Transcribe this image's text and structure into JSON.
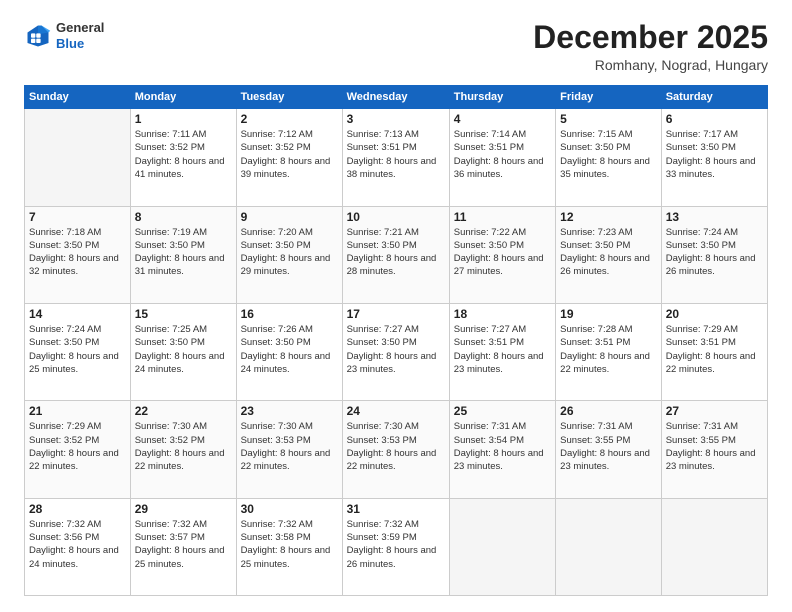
{
  "header": {
    "logo": {
      "general": "General",
      "blue": "Blue"
    },
    "title": "December 2025",
    "subtitle": "Romhany, Nograd, Hungary"
  },
  "days_of_week": [
    "Sunday",
    "Monday",
    "Tuesday",
    "Wednesday",
    "Thursday",
    "Friday",
    "Saturday"
  ],
  "weeks": [
    [
      {
        "day": "",
        "empty": true
      },
      {
        "day": "1",
        "sunrise": "7:11 AM",
        "sunset": "3:52 PM",
        "daylight": "8 hours and 41 minutes."
      },
      {
        "day": "2",
        "sunrise": "7:12 AM",
        "sunset": "3:52 PM",
        "daylight": "8 hours and 39 minutes."
      },
      {
        "day": "3",
        "sunrise": "7:13 AM",
        "sunset": "3:51 PM",
        "daylight": "8 hours and 38 minutes."
      },
      {
        "day": "4",
        "sunrise": "7:14 AM",
        "sunset": "3:51 PM",
        "daylight": "8 hours and 36 minutes."
      },
      {
        "day": "5",
        "sunrise": "7:15 AM",
        "sunset": "3:50 PM",
        "daylight": "8 hours and 35 minutes."
      },
      {
        "day": "6",
        "sunrise": "7:17 AM",
        "sunset": "3:50 PM",
        "daylight": "8 hours and 33 minutes."
      }
    ],
    [
      {
        "day": "7",
        "sunrise": "7:18 AM",
        "sunset": "3:50 PM",
        "daylight": "8 hours and 32 minutes."
      },
      {
        "day": "8",
        "sunrise": "7:19 AM",
        "sunset": "3:50 PM",
        "daylight": "8 hours and 31 minutes."
      },
      {
        "day": "9",
        "sunrise": "7:20 AM",
        "sunset": "3:50 PM",
        "daylight": "8 hours and 29 minutes."
      },
      {
        "day": "10",
        "sunrise": "7:21 AM",
        "sunset": "3:50 PM",
        "daylight": "8 hours and 28 minutes."
      },
      {
        "day": "11",
        "sunrise": "7:22 AM",
        "sunset": "3:50 PM",
        "daylight": "8 hours and 27 minutes."
      },
      {
        "day": "12",
        "sunrise": "7:23 AM",
        "sunset": "3:50 PM",
        "daylight": "8 hours and 26 minutes."
      },
      {
        "day": "13",
        "sunrise": "7:24 AM",
        "sunset": "3:50 PM",
        "daylight": "8 hours and 26 minutes."
      }
    ],
    [
      {
        "day": "14",
        "sunrise": "7:24 AM",
        "sunset": "3:50 PM",
        "daylight": "8 hours and 25 minutes."
      },
      {
        "day": "15",
        "sunrise": "7:25 AM",
        "sunset": "3:50 PM",
        "daylight": "8 hours and 24 minutes."
      },
      {
        "day": "16",
        "sunrise": "7:26 AM",
        "sunset": "3:50 PM",
        "daylight": "8 hours and 24 minutes."
      },
      {
        "day": "17",
        "sunrise": "7:27 AM",
        "sunset": "3:50 PM",
        "daylight": "8 hours and 23 minutes."
      },
      {
        "day": "18",
        "sunrise": "7:27 AM",
        "sunset": "3:51 PM",
        "daylight": "8 hours and 23 minutes."
      },
      {
        "day": "19",
        "sunrise": "7:28 AM",
        "sunset": "3:51 PM",
        "daylight": "8 hours and 22 minutes."
      },
      {
        "day": "20",
        "sunrise": "7:29 AM",
        "sunset": "3:51 PM",
        "daylight": "8 hours and 22 minutes."
      }
    ],
    [
      {
        "day": "21",
        "sunrise": "7:29 AM",
        "sunset": "3:52 PM",
        "daylight": "8 hours and 22 minutes."
      },
      {
        "day": "22",
        "sunrise": "7:30 AM",
        "sunset": "3:52 PM",
        "daylight": "8 hours and 22 minutes."
      },
      {
        "day": "23",
        "sunrise": "7:30 AM",
        "sunset": "3:53 PM",
        "daylight": "8 hours and 22 minutes."
      },
      {
        "day": "24",
        "sunrise": "7:30 AM",
        "sunset": "3:53 PM",
        "daylight": "8 hours and 22 minutes."
      },
      {
        "day": "25",
        "sunrise": "7:31 AM",
        "sunset": "3:54 PM",
        "daylight": "8 hours and 23 minutes."
      },
      {
        "day": "26",
        "sunrise": "7:31 AM",
        "sunset": "3:55 PM",
        "daylight": "8 hours and 23 minutes."
      },
      {
        "day": "27",
        "sunrise": "7:31 AM",
        "sunset": "3:55 PM",
        "daylight": "8 hours and 23 minutes."
      }
    ],
    [
      {
        "day": "28",
        "sunrise": "7:32 AM",
        "sunset": "3:56 PM",
        "daylight": "8 hours and 24 minutes."
      },
      {
        "day": "29",
        "sunrise": "7:32 AM",
        "sunset": "3:57 PM",
        "daylight": "8 hours and 25 minutes."
      },
      {
        "day": "30",
        "sunrise": "7:32 AM",
        "sunset": "3:58 PM",
        "daylight": "8 hours and 25 minutes."
      },
      {
        "day": "31",
        "sunrise": "7:32 AM",
        "sunset": "3:59 PM",
        "daylight": "8 hours and 26 minutes."
      },
      {
        "day": "",
        "empty": true
      },
      {
        "day": "",
        "empty": true
      },
      {
        "day": "",
        "empty": true
      }
    ]
  ]
}
